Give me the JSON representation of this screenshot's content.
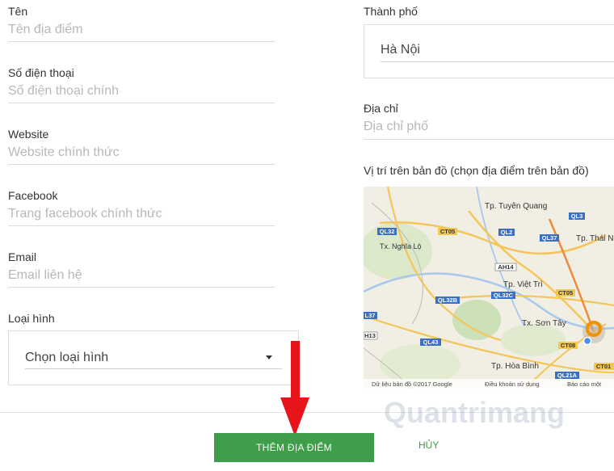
{
  "left_form": {
    "name": {
      "label": "Tên",
      "placeholder": "Tên địa điểm"
    },
    "phone": {
      "label": "Số điện thoại",
      "placeholder": "Số điện thoại chính"
    },
    "website": {
      "label": "Website",
      "placeholder": "Website chính thức"
    },
    "facebook": {
      "label": "Facebook",
      "placeholder": "Trang facebook chính thức"
    },
    "email": {
      "label": "Email",
      "placeholder": "Email liên hệ"
    },
    "type": {
      "label": "Loại hình",
      "value": "Chọn loại hình"
    }
  },
  "right_form": {
    "city": {
      "label": "Thành phố",
      "value": "Hà Nội"
    },
    "address": {
      "label": "Địa chỉ",
      "placeholder": "Địa chỉ phố"
    },
    "map_label": "Vị trí trên bản đồ (chọn địa điểm trên bản đồ)"
  },
  "map": {
    "places": [
      "Tp. Tuyên Quang",
      "Tp. Thái Nguyên",
      "Tx. Nghĩa Lộ",
      "Tp. Việt Trì",
      "Tx. Sơn Tây",
      "Tp. Hòa Bình"
    ],
    "roads": [
      "QL32",
      "CT05",
      "QL2",
      "QL3",
      "QL37",
      "AH14",
      "QL32B",
      "QL32C",
      "CT05",
      "L37",
      "H13",
      "QL43",
      "CT08",
      "QL21A",
      "CT01"
    ],
    "footer": {
      "data": "Dữ liệu bản đồ ©2017 Google",
      "terms": "Điều khoản sử dụng",
      "report": "Báo cáo một"
    }
  },
  "actions": {
    "add_label": "THÊM ĐỊA ĐIỂM",
    "cancel_label": "HỦY"
  },
  "colors": {
    "accent": "#3e9e49",
    "arrow": "#e8141c",
    "marker": "#f39200"
  }
}
